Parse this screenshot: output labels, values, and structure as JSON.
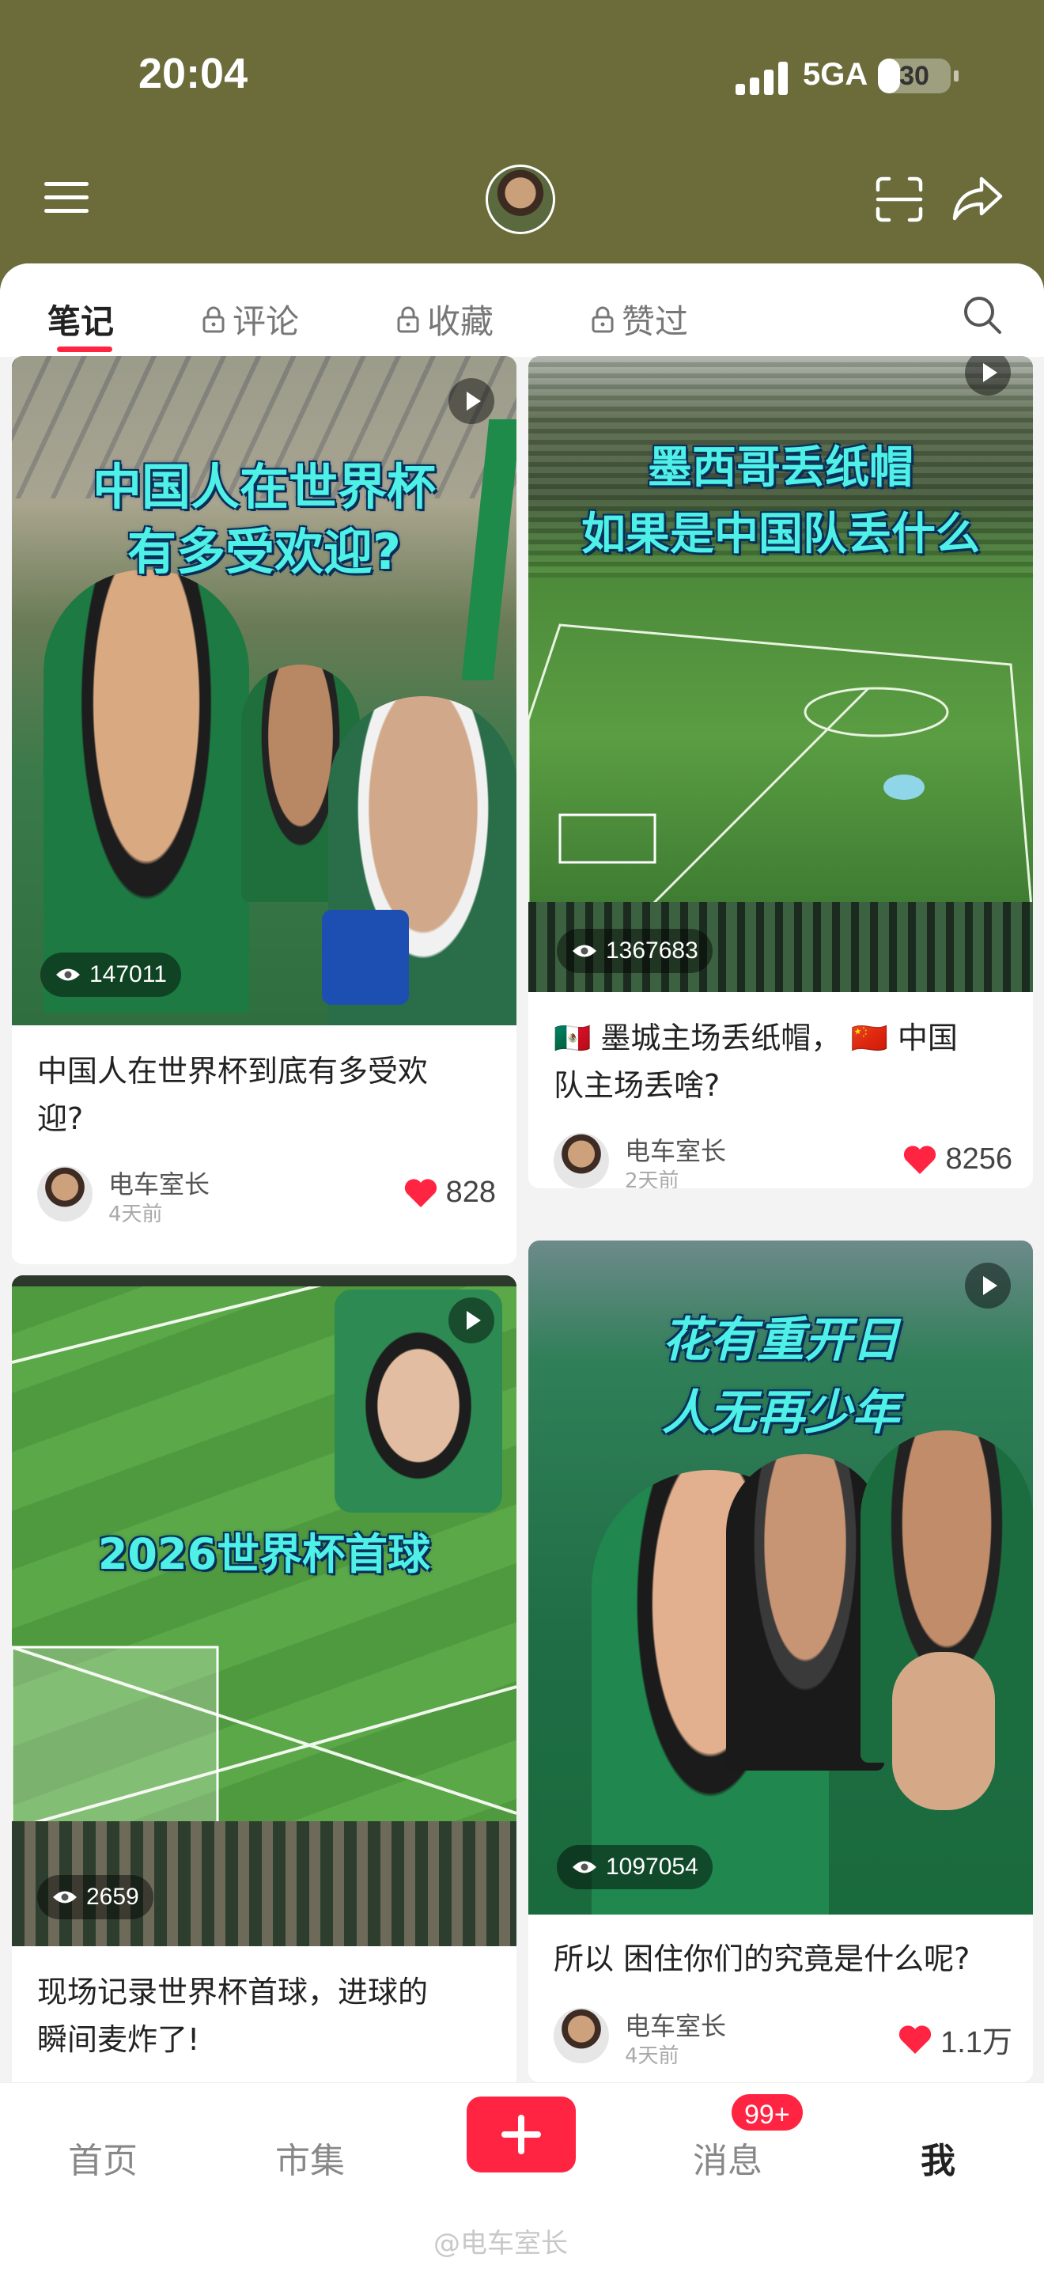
{
  "status_bar": {
    "time": "20:04",
    "network": "5GA",
    "battery": "30",
    "battery_level": 0.3
  },
  "header": {
    "menu_icon": "hamburger-icon",
    "scan_icon": "scan-icon",
    "share_icon": "share-icon"
  },
  "tabs": [
    {
      "label": "笔记",
      "locked": false,
      "active": true
    },
    {
      "label": "评论",
      "locked": true,
      "active": false
    },
    {
      "label": "收藏",
      "locked": true,
      "active": false
    },
    {
      "label": "赞过",
      "locked": true,
      "active": false
    }
  ],
  "posts": [
    {
      "overlay": [
        "中国人在世界杯",
        "有多受欢迎?"
      ],
      "views": "147011",
      "title_lines": [
        "中国人在世界杯到底有多受欢",
        "迎?"
      ],
      "author": "电车室长",
      "ago": "4天前",
      "likes": "828"
    },
    {
      "overlay": [
        "墨西哥丢纸帽",
        "如果是中国队丢什么"
      ],
      "views": "1367683",
      "title_lines": [
        "🇲🇽 墨城主场丢纸帽， 🇨🇳 中国",
        "队主场丢啥?"
      ],
      "author": "电车室长",
      "ago": "2天前",
      "likes": "8256"
    },
    {
      "overlay": [
        "2026世界杯首球"
      ],
      "views": "2659",
      "title_lines": [
        "现场记录世界杯首球，进球的",
        "瞬间麦炸了!"
      ]
    },
    {
      "overlay": [
        "花有重开日",
        "人无再少年"
      ],
      "views": "1097054",
      "title_lines": [
        "所以 困住你们的究竟是什么呢?"
      ],
      "author": "电车室长",
      "ago": "4天前",
      "likes": "1.1万"
    }
  ],
  "bottom_nav": {
    "home": "首页",
    "market": "市集",
    "messages": "消息",
    "me": "我",
    "badge": "99+"
  },
  "watermark": "@电车室长",
  "colors": {
    "accent": "#ff2442",
    "header_bg": "#6b6c3a",
    "overlay_text": "#4ff0e6"
  }
}
